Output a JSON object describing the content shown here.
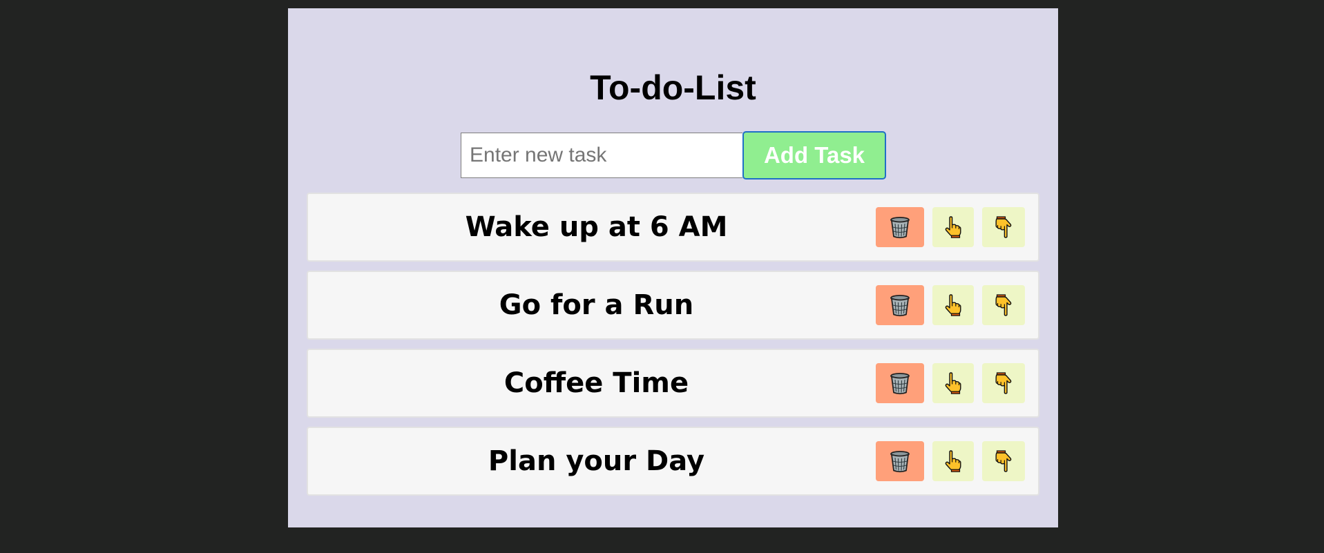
{
  "app": {
    "title": "To-do-List"
  },
  "input": {
    "placeholder": "Enter new task",
    "value": ""
  },
  "add_button": {
    "label": "Add Task"
  },
  "tasks": [
    {
      "text": "Wake up at 6 AM"
    },
    {
      "text": "Go for a Run"
    },
    {
      "text": "Coffee Time"
    },
    {
      "text": "Plan your Day"
    }
  ],
  "task_actions": {
    "delete_icon": "wastebasket-icon",
    "move_up_icon": "hand-pointing-up-icon",
    "move_down_icon": "hand-pointing-down-icon"
  },
  "colors": {
    "page_background": "#222322",
    "card_background": "#dad8ea",
    "add_button": "#90ee90",
    "delete_button": "#ffa07a",
    "move_button": "#eef6c6",
    "task_background": "#f6f6f6"
  }
}
